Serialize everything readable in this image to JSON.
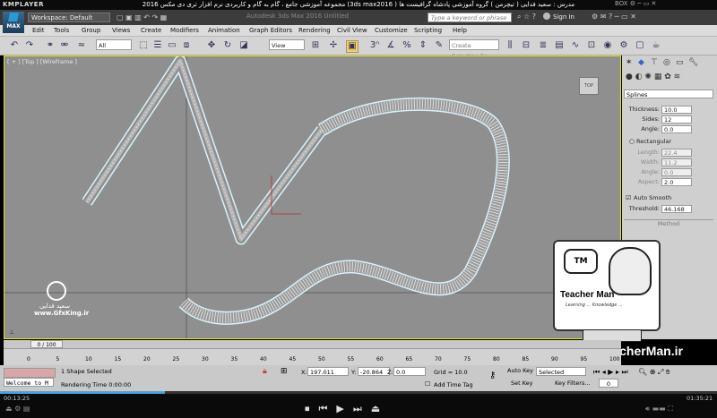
{
  "kmplayer": {
    "logo": "KMPLAYER",
    "title": "مجموعه آموزشی جامع ، گام به گام و کاربردی نرم افزار تری دی مکس 2016 (3ds max2016 ) مدرس : سعید فدایی ( تیچرمن ) گروه آموزشی پادشاه گرافیست ها",
    "controls": "BOX ⚙ ─ ▭ ✕"
  },
  "max": {
    "logo_label": "MAX",
    "workspace": "Workspace: Default",
    "filename": "Autodesk 3ds Max 2016    Untitled",
    "search_placeholder": "Type a keyword or phrase",
    "signin": "Sign In"
  },
  "menu": [
    "Edit",
    "Tools",
    "Group",
    "Views",
    "Create",
    "Modifiers",
    "Animation",
    "Graph Editors",
    "Rendering",
    "Civil View",
    "Customize",
    "Scripting",
    "Help"
  ],
  "toolbar": {
    "filter_select": "All",
    "view_select": "View",
    "selection_set": "Create Selection Se"
  },
  "viewport": {
    "label": "[ + ] [Top ] [Wireframe ]",
    "viewcube": "TOP"
  },
  "panel": {
    "dropdown": "Splines",
    "thickness_label": "Thickness:",
    "thickness": "10.0",
    "sides_label": "Sides:",
    "sides": "12",
    "angle_label": "Angle:",
    "angle": "0.0",
    "rect_label": "Rectangular",
    "length_label": "Length:",
    "length": "22.4",
    "width_label": "Width:",
    "width": "11.2",
    "angle2_label": "Angle:",
    "angle2": "0.0",
    "aspect_label": "Aspect:",
    "aspect": "2.0",
    "auto_smooth": "Auto Smooth",
    "threshold_label": "Threshold:",
    "threshold": "46.168",
    "method": "Method"
  },
  "timeline": {
    "frame": "0 / 100",
    "ticks": [
      "0",
      "5",
      "10",
      "15",
      "20",
      "25",
      "30",
      "35",
      "40",
      "45",
      "50",
      "55",
      "60",
      "65",
      "70",
      "75",
      "80",
      "85",
      "90",
      "95",
      "100"
    ]
  },
  "status": {
    "welcome": "Welcome to M",
    "selected": "1 Shape Selected",
    "rendering": "Rendering Time  0:00:00",
    "x_label": "X:",
    "x": "197.011",
    "y_label": "Y:",
    "y": "-20.864",
    "z_label": "Z:",
    "z": "0.0",
    "grid": "Grid = 10.0",
    "add_time_tag": "Add Time Tag",
    "auto_key": "Auto Key",
    "selected_key": "Selected",
    "set_key": "Set Key",
    "key_filters": "Key Filters...",
    "frame_num": "0"
  },
  "player": {
    "time_elapsed": "00:13:25",
    "time_total": "01:35:21",
    "progress": 0.23
  },
  "overlay": {
    "teacher_name": "Teacher Man",
    "teacher_sub": "Learning ... Knowledge ...",
    "website": "www.TeacherMan.ir",
    "left_logo_name": "سعید فدایی",
    "left_logo_site": "www.GfxKing.ir"
  }
}
